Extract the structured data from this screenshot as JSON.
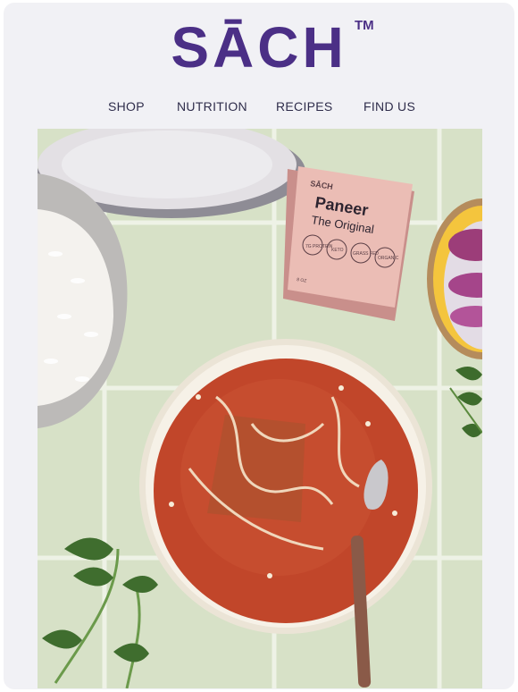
{
  "brand": {
    "logo_text": "SĀCH",
    "trademark": "TM"
  },
  "nav": {
    "items": [
      {
        "label": "SHOP"
      },
      {
        "label": "NUTRITION"
      },
      {
        "label": "RECIPES"
      },
      {
        "label": "FIND US"
      }
    ]
  },
  "hero": {
    "package": {
      "brand": "SĀCH",
      "product": "Paneer",
      "variant": "The Original",
      "badges": [
        "7G PROTEIN",
        "KETO",
        "GRASS FED",
        "ORGANIC"
      ],
      "weight": "8 OZ"
    }
  },
  "colors": {
    "brand_purple": "#4b2f86",
    "background": "#f1f1f5",
    "tile": "#d6e0c6",
    "curry": "#c1462a",
    "package_pink": "#e8b9b3"
  }
}
